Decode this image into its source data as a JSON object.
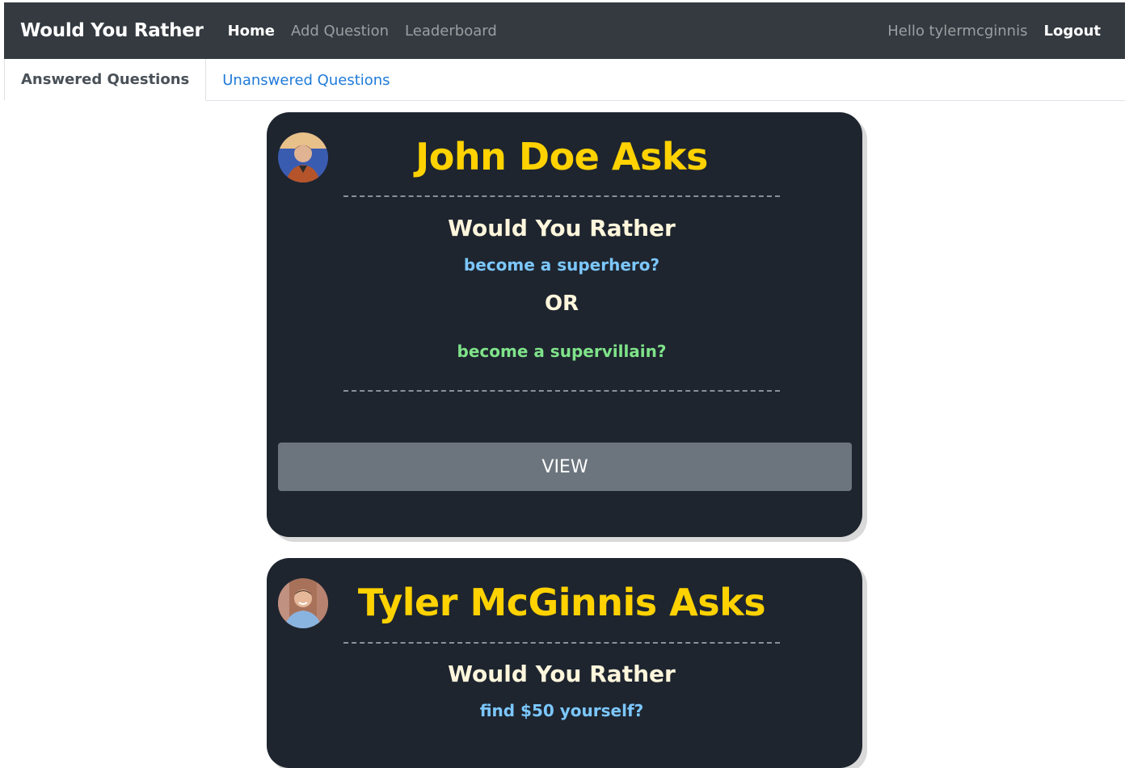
{
  "navbar": {
    "brand": "Would You Rather",
    "links": [
      "Home",
      "Add Question",
      "Leaderboard"
    ],
    "greeting": "Hello tylermcginnis",
    "logout": "Logout"
  },
  "tabs": [
    "Answered Questions",
    "Unanswered Questions"
  ],
  "questions": [
    {
      "title": "John Doe Asks",
      "heading": "Would You Rather",
      "option_one": "become a superhero?",
      "or": "OR",
      "option_two": "become a supervillain?",
      "button": "VIEW"
    },
    {
      "title": "Tyler McGinnis Asks",
      "heading": "Would You Rather",
      "option_one": "find $50 yourself?"
    }
  ],
  "colors": {
    "navbar_bg": "#343a40",
    "card_bg": "#1e252f",
    "title": "#ffd200",
    "option_one": "#7cc7ff",
    "option_two": "#7fe389",
    "button": "#6c757d",
    "tab_link": "#1f7ad9"
  }
}
